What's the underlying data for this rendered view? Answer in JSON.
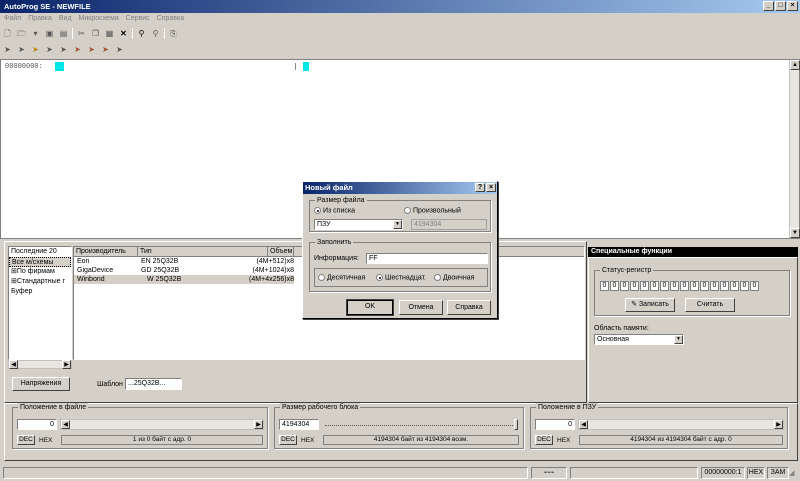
{
  "window": {
    "title": "AutoProg SE - NEWFILE",
    "min": "_",
    "max": "□",
    "close": "×"
  },
  "menu": [
    "Файл",
    "Правка",
    "Вид",
    "Микросхема",
    "Сервис",
    "Справка"
  ],
  "hex": {
    "address": "00000000:"
  },
  "tree": [
    "Последние 20",
    "Все м/схемы",
    "По фирмам",
    "Стандартные г",
    "Буфер"
  ],
  "chiplist": {
    "headers": [
      "Производитель",
      "Тип",
      "Объем"
    ],
    "rows": [
      {
        "vendor": "Eon",
        "type": "EN 25Q32B",
        "size": "(4M+512)x8"
      },
      {
        "vendor": "GigaDevice",
        "type": "GD 25Q32B",
        "size": "(4M+1024)x8"
      },
      {
        "vendor": "Winbond",
        "type": "W 25Q32B",
        "size": "(4M+4x256)x8"
      }
    ]
  },
  "bottom": {
    "voltage_button": "Напряжения",
    "template_label": "Шаблон",
    "template_value": "...25Q32B..."
  },
  "special": {
    "header": "Специальные функции",
    "status_group": "Статус-регистр",
    "bits": [
      "0",
      "0",
      "0",
      "0",
      "0",
      "0",
      "0",
      "0",
      "0",
      "0",
      "0",
      "0",
      "0",
      "0",
      "0",
      "0"
    ],
    "write_button": "Записать",
    "read_button": "Считать",
    "memory_label": "Область памяти:",
    "memory_value": "Основная"
  },
  "pos_file": {
    "title": "Положение в файле",
    "value": "0",
    "dec": "DEC",
    "hex": "HEX",
    "info": "1 из 0 байт с адр. 0"
  },
  "block": {
    "title": "Размер рабочего блока",
    "value": "4194304",
    "dec": "DEC",
    "hex": "HEX",
    "info": "4194304 байт из 4194304 возм."
  },
  "pos_rom": {
    "title": "Положение в ПЗУ",
    "value": "0",
    "dec": "DEC",
    "hex": "HEX",
    "info": "4194304 из 4194304 байт с адр. 0"
  },
  "status": {
    "addr": "00000000:1",
    "mode": "HEX",
    "ins": "ЗАМ"
  },
  "dialog": {
    "title": "Новый файл",
    "help": "?",
    "close": "×",
    "size_group": "Размер файла",
    "from_list": "Из списка",
    "arbitrary": "Произвольный",
    "list_value": "ПЗУ",
    "size_value": "4194304",
    "fill_group": "Заполнить",
    "info_label": "Информация:",
    "info_value": "FF",
    "dec": "Десятичная",
    "hex": "Шестнадцат.",
    "bin": "Двоичная",
    "ok": "OK",
    "cancel": "Отмена",
    "helpbtn": "Справка"
  }
}
